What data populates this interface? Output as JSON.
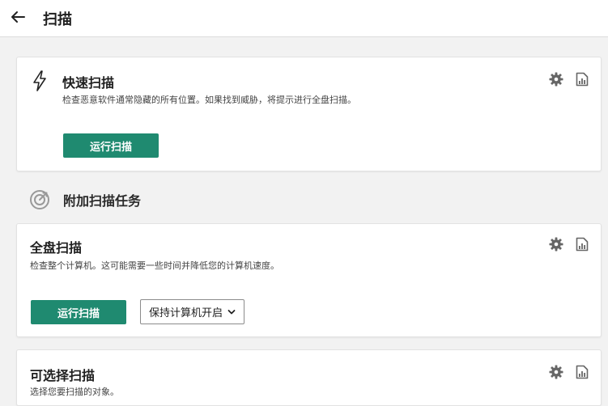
{
  "header": {
    "title": "扫描"
  },
  "quick_scan": {
    "title": "快速扫描",
    "description": "检查恶意软件通常隐藏的所有位置。如果找到威胁，将提示进行全盘扫描。",
    "run_label": "运行扫描"
  },
  "additional": {
    "title": "附加扫描任务"
  },
  "full_scan": {
    "title": "全盘扫描",
    "description": "检查整个计算机。这可能需要一些时间并降低您的计算机速度。",
    "run_label": "运行扫描",
    "dropdown_value": "保持计算机开启"
  },
  "custom_scan": {
    "title": "可选择扫描",
    "description": "选择您要扫描的对象。"
  },
  "colors": {
    "accent": "#1f8a70",
    "icon": "#666666"
  }
}
